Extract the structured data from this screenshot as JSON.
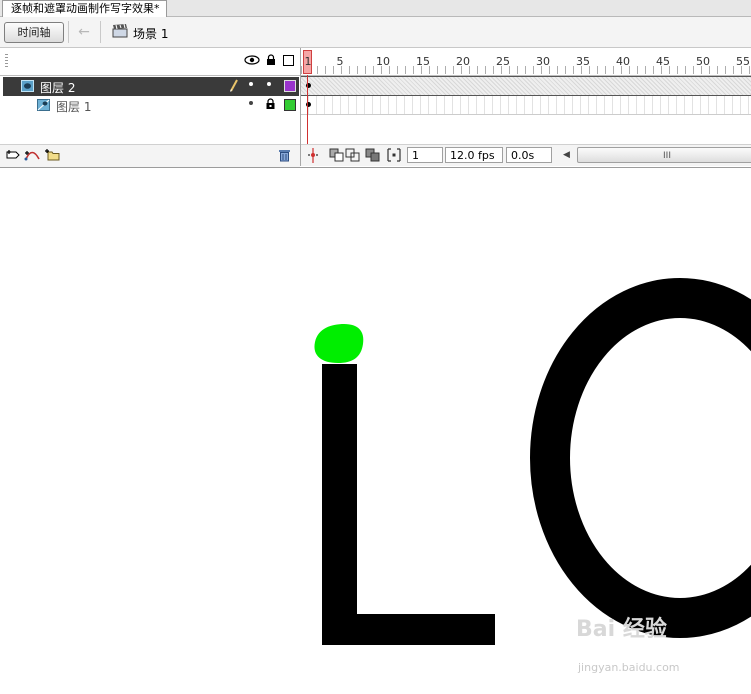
{
  "document": {
    "tab_title": "逐帧和遮罩动画制作写字效果*"
  },
  "toolbar": {
    "timeline_button": "时间轴",
    "scene_label": "场景 1"
  },
  "timeline": {
    "ruler_labels": [
      "1",
      "5",
      "10",
      "15",
      "20",
      "25",
      "30",
      "35",
      "40",
      "45",
      "50",
      "55"
    ],
    "layers": [
      {
        "name": "图层 2",
        "selected": true,
        "outline_color": "#9933cc"
      },
      {
        "name": "图层 1",
        "selected": false,
        "outline_color": "#33cc33"
      }
    ],
    "current_frame": "1",
    "frame_rate": "12.0 fps",
    "elapsed_time": "0.0s",
    "scrollbar_grip": "III"
  },
  "stage": {
    "letters": "LO",
    "brush_color": "#00ee00"
  },
  "watermark": {
    "logo": "Bai 经验",
    "url": "jingyan.baidu.com"
  }
}
